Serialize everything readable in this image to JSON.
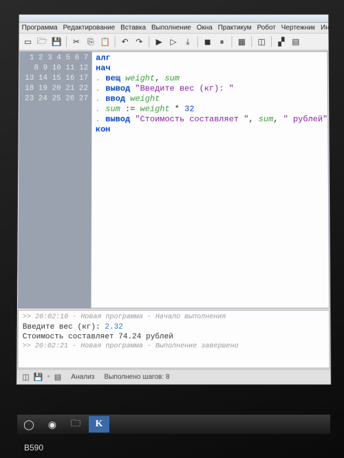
{
  "menu": {
    "items": [
      "Программа",
      "Редактирование",
      "Вставка",
      "Выполнение",
      "Окна",
      "Практикум",
      "Робот",
      "Чертежник",
      "Инфо"
    ]
  },
  "toolbar": {
    "icons": [
      "new-file-icon",
      "open-icon",
      "save-icon",
      "sep",
      "cut-icon",
      "copy-icon",
      "paste-icon",
      "sep",
      "undo-icon",
      "redo-icon",
      "sep",
      "run-icon",
      "step-icon",
      "step-over-icon",
      "sep",
      "stop-icon",
      "pause-icon",
      "sep",
      "grid-icon",
      "sep",
      "window-icon",
      "sep",
      "palette-icon",
      "tiles-icon"
    ]
  },
  "code": {
    "lines": 27,
    "l1_kw": "алг",
    "l2_kw": "нач",
    "l3_dot": ". ",
    "l3_kw": "вещ",
    "l3_i1": " weight",
    "l3_c": ", ",
    "l3_i2": "sum",
    "l4_dot": ". ",
    "l4_kw": "вывод",
    "l4_s": " \"Введите вес (кг): \"",
    "l5_dot": ". ",
    "l5_kw": "ввод",
    "l5_i": " weight",
    "l6_dot": ". ",
    "l6_i1": "sum",
    "l6_op": " := ",
    "l6_i2": "weight",
    "l6_m": " * ",
    "l6_n": "32",
    "l7_dot": ". ",
    "l7_kw": "вывод",
    "l7_s1": " \"Стоимость составляет \"",
    "l7_c1": ", ",
    "l7_i": "sum",
    "l7_c2": ", ",
    "l7_s2": "\" рублей\"",
    "l8_kw": "кон"
  },
  "output": {
    "meta1": ">> 20:02:10 - Новая программа - Начало выполнения",
    "prompt": "Введите вес (кг): ",
    "input_val": "2.32",
    "result": "Стоимость составляет 74.24 рублей",
    "meta2": ">> 20:02:21 - Новая программа - Выполнение завершено"
  },
  "status": {
    "analysis": "Анализ",
    "steps": "Выполнено шагов: 8"
  },
  "taskbar": {
    "k_label": "K"
  },
  "laptop": {
    "model": "B590"
  }
}
